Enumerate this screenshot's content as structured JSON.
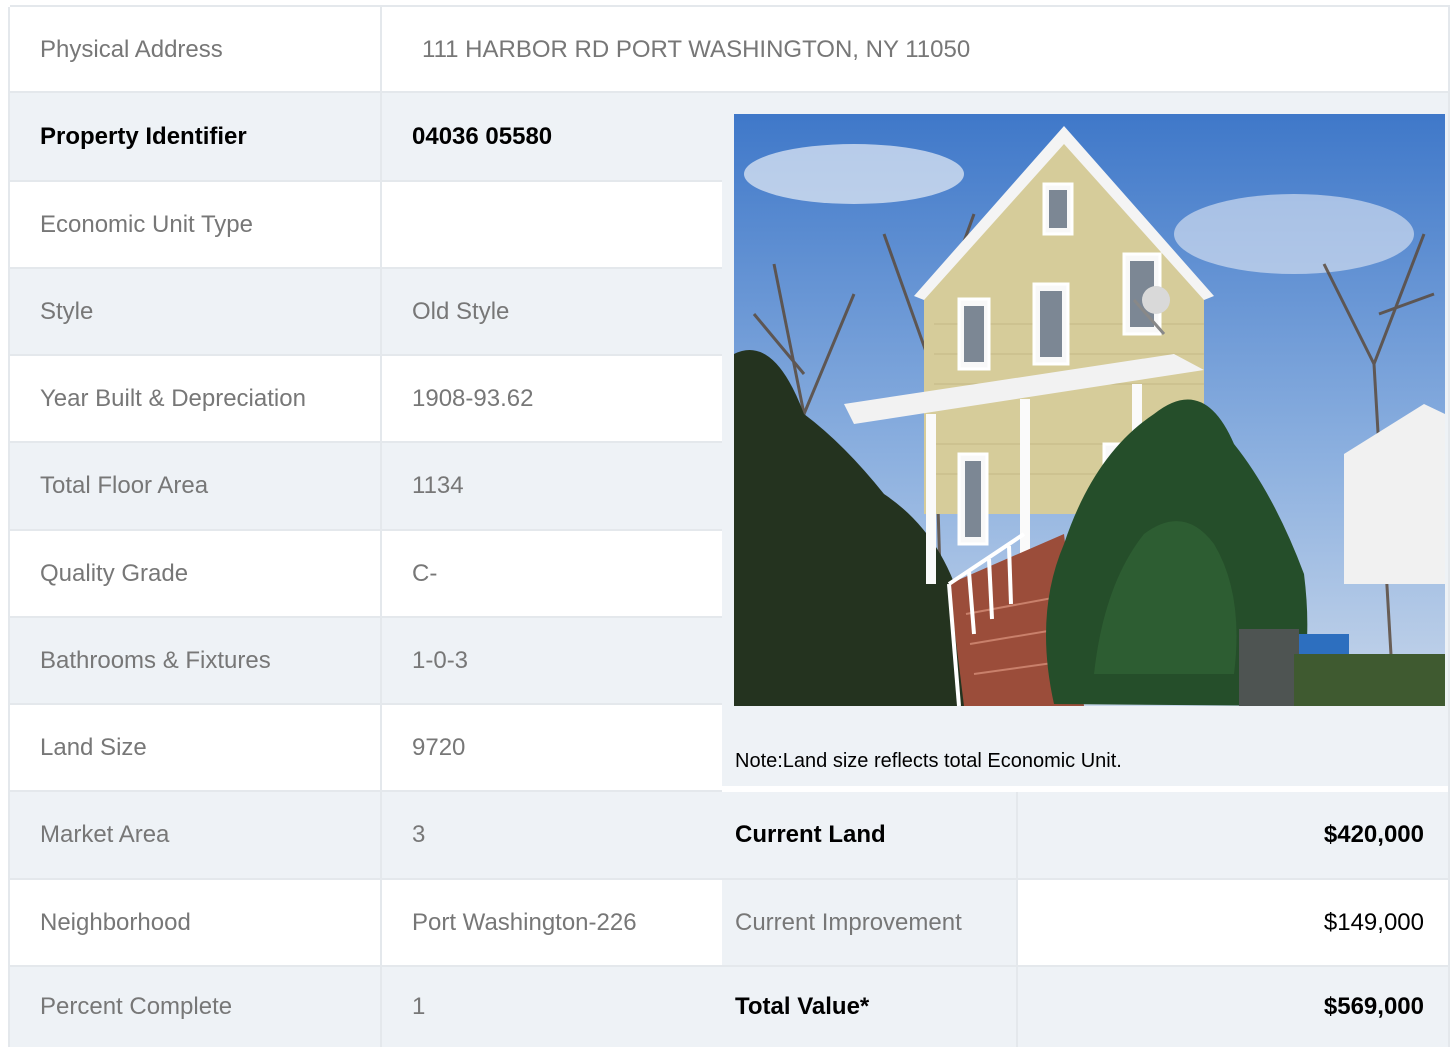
{
  "address": {
    "label": "Physical Address",
    "value": "111  HARBOR RD  PORT WASHINGTON, NY  11050"
  },
  "details": [
    {
      "label": "Property Identifier",
      "value": "04036  05580"
    },
    {
      "label": "Economic Unit Type",
      "value": ""
    },
    {
      "label": "Style",
      "value": "Old Style"
    },
    {
      "label": "Year Built & Depreciation",
      "value": "1908-93.62"
    },
    {
      "label": "Total Floor Area",
      "value": "1134"
    },
    {
      "label": "Quality Grade",
      "value": "C-"
    },
    {
      "label": "Bathrooms & Fixtures",
      "value": "1-0-3"
    },
    {
      "label": "Land Size",
      "value": "9720"
    },
    {
      "label": "Market Area",
      "value": "3"
    },
    {
      "label": "Neighborhood",
      "value": "Port Washington-226"
    },
    {
      "label": "Percent Complete",
      "value": "1"
    }
  ],
  "note": "Note:Land size reflects total Economic Unit.",
  "valuation": [
    {
      "label": "Current Land",
      "value": "$420,000"
    },
    {
      "label": "Current Improvement",
      "value": "$149,000"
    },
    {
      "label": "Total Value*",
      "value": "$569,000"
    }
  ],
  "colors": {
    "row_grey": "#eef2f6",
    "row_white": "#ffffff",
    "border": "#e4e8ec",
    "label_text": "#777777",
    "bold_text": "#000000"
  }
}
